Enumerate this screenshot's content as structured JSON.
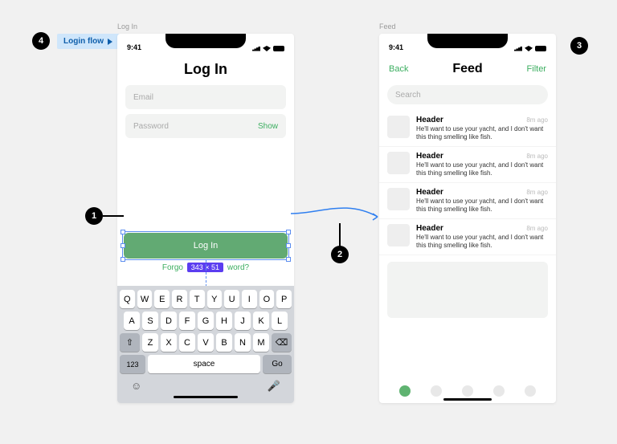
{
  "frames": {
    "login_label": "Log In",
    "feed_label": "Feed"
  },
  "statusbar": {
    "time": "9:41"
  },
  "login": {
    "title": "Log In",
    "email_placeholder": "Email",
    "password_placeholder": "Password",
    "show_label": "Show",
    "button_label": "Log In",
    "forgot_prefix": "Forgo",
    "size_badge": "343 × 51",
    "forgot_suffix": "word?"
  },
  "keyboard": {
    "row1": [
      "Q",
      "W",
      "E",
      "R",
      "T",
      "Y",
      "U",
      "I",
      "O",
      "P"
    ],
    "row2": [
      "A",
      "S",
      "D",
      "F",
      "G",
      "H",
      "J",
      "K",
      "L"
    ],
    "row3": [
      "Z",
      "X",
      "C",
      "V",
      "B",
      "N",
      "M"
    ],
    "shift": "⇧",
    "backspace": "⌫",
    "numbers": "123",
    "space": "space",
    "go": "Go",
    "emoji": "☺",
    "mic": "🎤"
  },
  "feed": {
    "back": "Back",
    "title": "Feed",
    "filter": "Filter",
    "search_placeholder": "Search",
    "items": [
      {
        "header": "Header",
        "time": "8m ago",
        "body": "He'll want to use your yacht, and I don't want this thing smelling like fish."
      },
      {
        "header": "Header",
        "time": "8m ago",
        "body": "He'll want to use your yacht, and I don't want this thing smelling like fish."
      },
      {
        "header": "Header",
        "time": "8m ago",
        "body": "He'll want to use your yacht, and I don't want this thing smelling like fish."
      },
      {
        "header": "Header",
        "time": "8m ago",
        "body": "He'll want to use your yacht, and I don't want this thing smelling like fish."
      }
    ]
  },
  "callouts": {
    "one": "1",
    "two": "2",
    "three": "3",
    "four": "4"
  },
  "flow_tag": "Login flow"
}
